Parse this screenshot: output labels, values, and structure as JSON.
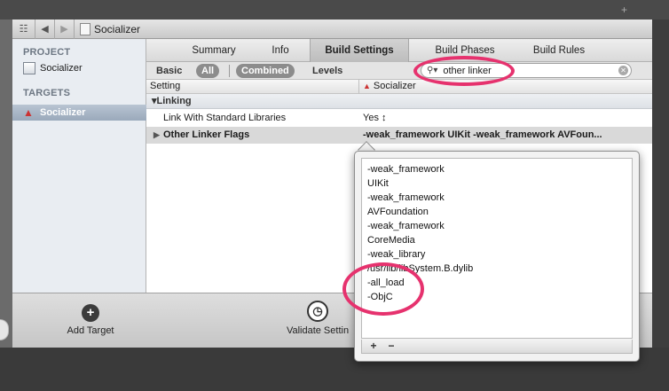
{
  "window": {
    "title": "Socializer"
  },
  "sidebar": {
    "project_header": "PROJECT",
    "project_item": "Socializer",
    "targets_header": "TARGETS",
    "target_item": "Socializer"
  },
  "tabs": [
    "Summary",
    "Info",
    "Build Settings",
    "Build Phases",
    "Build Rules"
  ],
  "active_tab": "Build Settings",
  "filter": {
    "basic": "Basic",
    "all": "All",
    "combined": "Combined",
    "levels": "Levels"
  },
  "search": {
    "value": "other linker"
  },
  "columns": {
    "setting": "Setting",
    "target": "Socializer"
  },
  "section": {
    "title": "Linking"
  },
  "rows": [
    {
      "name": "Link With Standard Libraries",
      "value": "Yes ↕"
    },
    {
      "name": "Other Linker Flags",
      "value": "-weak_framework UIKit -weak_framework AVFoun..."
    }
  ],
  "popover": {
    "lines": [
      "-weak_framework",
      "UIKit",
      "-weak_framework",
      "AVFoundation",
      "-weak_framework",
      "CoreMedia",
      "-weak_library",
      "/usr/lib/libSystem.B.dylib",
      "-all_load",
      "-ObjC"
    ],
    "add": "+",
    "remove": "−"
  },
  "bottom": {
    "add_target": "Add Target",
    "validate": "Validate Settin"
  },
  "annotation_color": "#e6326e"
}
